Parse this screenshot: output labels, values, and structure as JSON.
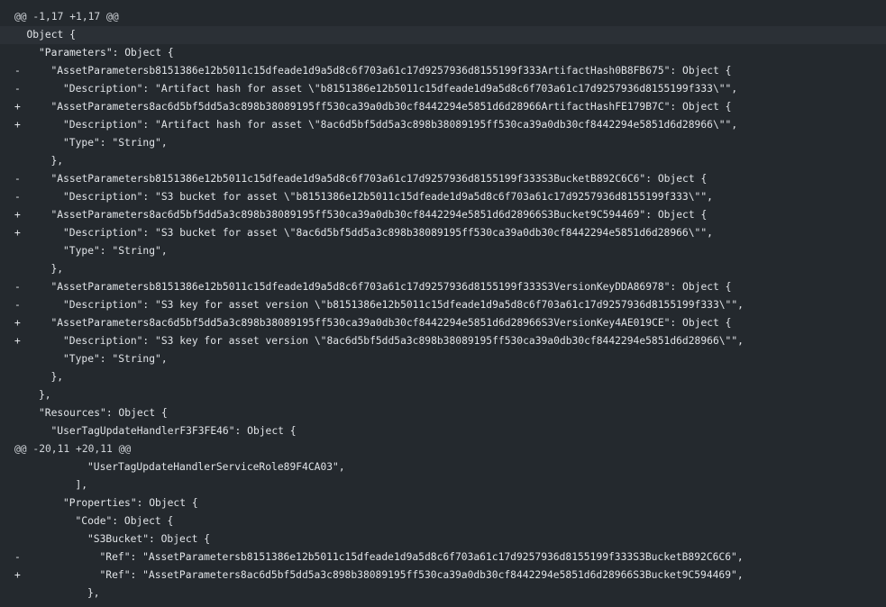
{
  "diff": {
    "lines": [
      {
        "marker": "",
        "text": "@@ -1,17 +1,17 @@",
        "kind": "hunk",
        "indent": 0
      },
      {
        "marker": "",
        "text": "Object {",
        "kind": "ctx",
        "indent": 1,
        "highlight": true
      },
      {
        "marker": "",
        "text": "\"Parameters\": Object {",
        "kind": "ctx",
        "indent": 2
      },
      {
        "marker": "-",
        "text": "\"AssetParametersb8151386e12b5011c15dfeade1d9a5d8c6f703a61c17d9257936d8155199f333ArtifactHash0B8FB675\": Object {",
        "kind": "del",
        "indent": 3
      },
      {
        "marker": "-",
        "text": "\"Description\": \"Artifact hash for asset \\\"b8151386e12b5011c15dfeade1d9a5d8c6f703a61c17d9257936d8155199f333\\\"\",",
        "kind": "del",
        "indent": 4
      },
      {
        "marker": "+",
        "text": "\"AssetParameters8ac6d5bf5dd5a3c898b38089195ff530ca39a0db30cf8442294e5851d6d28966ArtifactHashFE179B7C\": Object {",
        "kind": "add",
        "indent": 3
      },
      {
        "marker": "+",
        "text": "\"Description\": \"Artifact hash for asset \\\"8ac6d5bf5dd5a3c898b38089195ff530ca39a0db30cf8442294e5851d6d28966\\\"\",",
        "kind": "add",
        "indent": 4
      },
      {
        "marker": "",
        "text": "\"Type\": \"String\",",
        "kind": "ctx",
        "indent": 4
      },
      {
        "marker": "",
        "text": "},",
        "kind": "ctx",
        "indent": 3
      },
      {
        "marker": "-",
        "text": "\"AssetParametersb8151386e12b5011c15dfeade1d9a5d8c6f703a61c17d9257936d8155199f333S3BucketB892C6C6\": Object {",
        "kind": "del",
        "indent": 3
      },
      {
        "marker": "-",
        "text": "\"Description\": \"S3 bucket for asset \\\"b8151386e12b5011c15dfeade1d9a5d8c6f703a61c17d9257936d8155199f333\\\"\",",
        "kind": "del",
        "indent": 4
      },
      {
        "marker": "+",
        "text": "\"AssetParameters8ac6d5bf5dd5a3c898b38089195ff530ca39a0db30cf8442294e5851d6d28966S3Bucket9C594469\": Object {",
        "kind": "add",
        "indent": 3
      },
      {
        "marker": "+",
        "text": "\"Description\": \"S3 bucket for asset \\\"8ac6d5bf5dd5a3c898b38089195ff530ca39a0db30cf8442294e5851d6d28966\\\"\",",
        "kind": "add",
        "indent": 4
      },
      {
        "marker": "",
        "text": "\"Type\": \"String\",",
        "kind": "ctx",
        "indent": 4
      },
      {
        "marker": "",
        "text": "},",
        "kind": "ctx",
        "indent": 3
      },
      {
        "marker": "-",
        "text": "\"AssetParametersb8151386e12b5011c15dfeade1d9a5d8c6f703a61c17d9257936d8155199f333S3VersionKeyDDA86978\": Object {",
        "kind": "del",
        "indent": 3
      },
      {
        "marker": "-",
        "text": "\"Description\": \"S3 key for asset version \\\"b8151386e12b5011c15dfeade1d9a5d8c6f703a61c17d9257936d8155199f333\\\"\",",
        "kind": "del",
        "indent": 4
      },
      {
        "marker": "+",
        "text": "\"AssetParameters8ac6d5bf5dd5a3c898b38089195ff530ca39a0db30cf8442294e5851d6d28966S3VersionKey4AE019CE\": Object {",
        "kind": "add",
        "indent": 3
      },
      {
        "marker": "+",
        "text": "\"Description\": \"S3 key for asset version \\\"8ac6d5bf5dd5a3c898b38089195ff530ca39a0db30cf8442294e5851d6d28966\\\"\",",
        "kind": "add",
        "indent": 4
      },
      {
        "marker": "",
        "text": "\"Type\": \"String\",",
        "kind": "ctx",
        "indent": 4
      },
      {
        "marker": "",
        "text": "},",
        "kind": "ctx",
        "indent": 3
      },
      {
        "marker": "",
        "text": "},",
        "kind": "ctx",
        "indent": 2
      },
      {
        "marker": "",
        "text": "\"Resources\": Object {",
        "kind": "ctx",
        "indent": 2
      },
      {
        "marker": "",
        "text": "\"UserTagUpdateHandlerF3F3FE46\": Object {",
        "kind": "ctx",
        "indent": 3
      },
      {
        "marker": "",
        "text": "@@ -20,11 +20,11 @@",
        "kind": "hunk",
        "indent": 0
      },
      {
        "marker": "",
        "text": "\"UserTagUpdateHandlerServiceRole89F4CA03\",",
        "kind": "ctx",
        "indent": 6
      },
      {
        "marker": "",
        "text": "],",
        "kind": "ctx",
        "indent": 5
      },
      {
        "marker": "",
        "text": "\"Properties\": Object {",
        "kind": "ctx",
        "indent": 4
      },
      {
        "marker": "",
        "text": "\"Code\": Object {",
        "kind": "ctx",
        "indent": 5
      },
      {
        "marker": "",
        "text": "\"S3Bucket\": Object {",
        "kind": "ctx",
        "indent": 6
      },
      {
        "marker": "-",
        "text": "\"Ref\": \"AssetParametersb8151386e12b5011c15dfeade1d9a5d8c6f703a61c17d9257936d8155199f333S3BucketB892C6C6\",",
        "kind": "del",
        "indent": 7
      },
      {
        "marker": "+",
        "text": "\"Ref\": \"AssetParameters8ac6d5bf5dd5a3c898b38089195ff530ca39a0db30cf8442294e5851d6d28966S3Bucket9C594469\",",
        "kind": "add",
        "indent": 7
      },
      {
        "marker": "",
        "text": "},",
        "kind": "ctx",
        "indent": 6
      }
    ]
  }
}
